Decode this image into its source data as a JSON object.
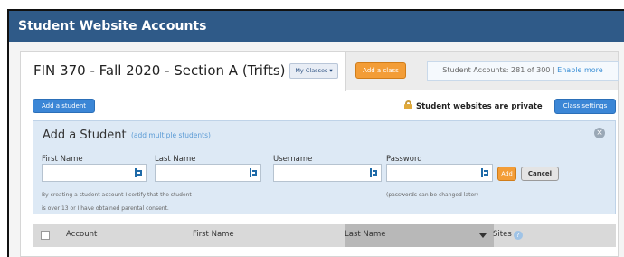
{
  "window": {
    "title": "Student Website Accounts"
  },
  "class": {
    "title": "FIN 370 - Fall 2020 - Section A (Trifts)",
    "my_classes_label": "My Classes ▾",
    "add_class_label": "Add a class",
    "accounts_text": "Student Accounts: 281 of 300 |",
    "enable_more_label": "Enable more"
  },
  "toolbar": {
    "add_student_label": "Add a student",
    "private_text": "Student websites are private",
    "class_settings_label": "Class settings"
  },
  "add_student_form": {
    "title": "Add a Student",
    "add_multiple_label": "(add multiple students)",
    "close_glyph": "×",
    "first_name_label": "First Name",
    "first_name_value": "",
    "last_name_label": "Last Name",
    "last_name_value": "",
    "username_label": "Username",
    "username_value": "",
    "password_label": "Password",
    "password_value": "",
    "add_label": "Add",
    "cancel_label": "Cancel",
    "consent_line1": "By creating a student account I certify that the student",
    "consent_line2": "is over 13 or I have obtained parental consent.",
    "password_note": "(passwords can be changed later)"
  },
  "table": {
    "columns": [
      "Account",
      "First Name",
      "Last Name",
      "Sites"
    ],
    "sorted_column": "Last Name"
  },
  "colors": {
    "title_bar": "#2f5a88",
    "primary_button": "#3b86d6",
    "orange_button": "#f39d37",
    "form_background": "#dde9f5",
    "link": "#3a8fd6"
  },
  "icons": [
    "lock-icon",
    "close-icon",
    "field-autofill-icon",
    "sort-caret-icon",
    "help-icon"
  ]
}
